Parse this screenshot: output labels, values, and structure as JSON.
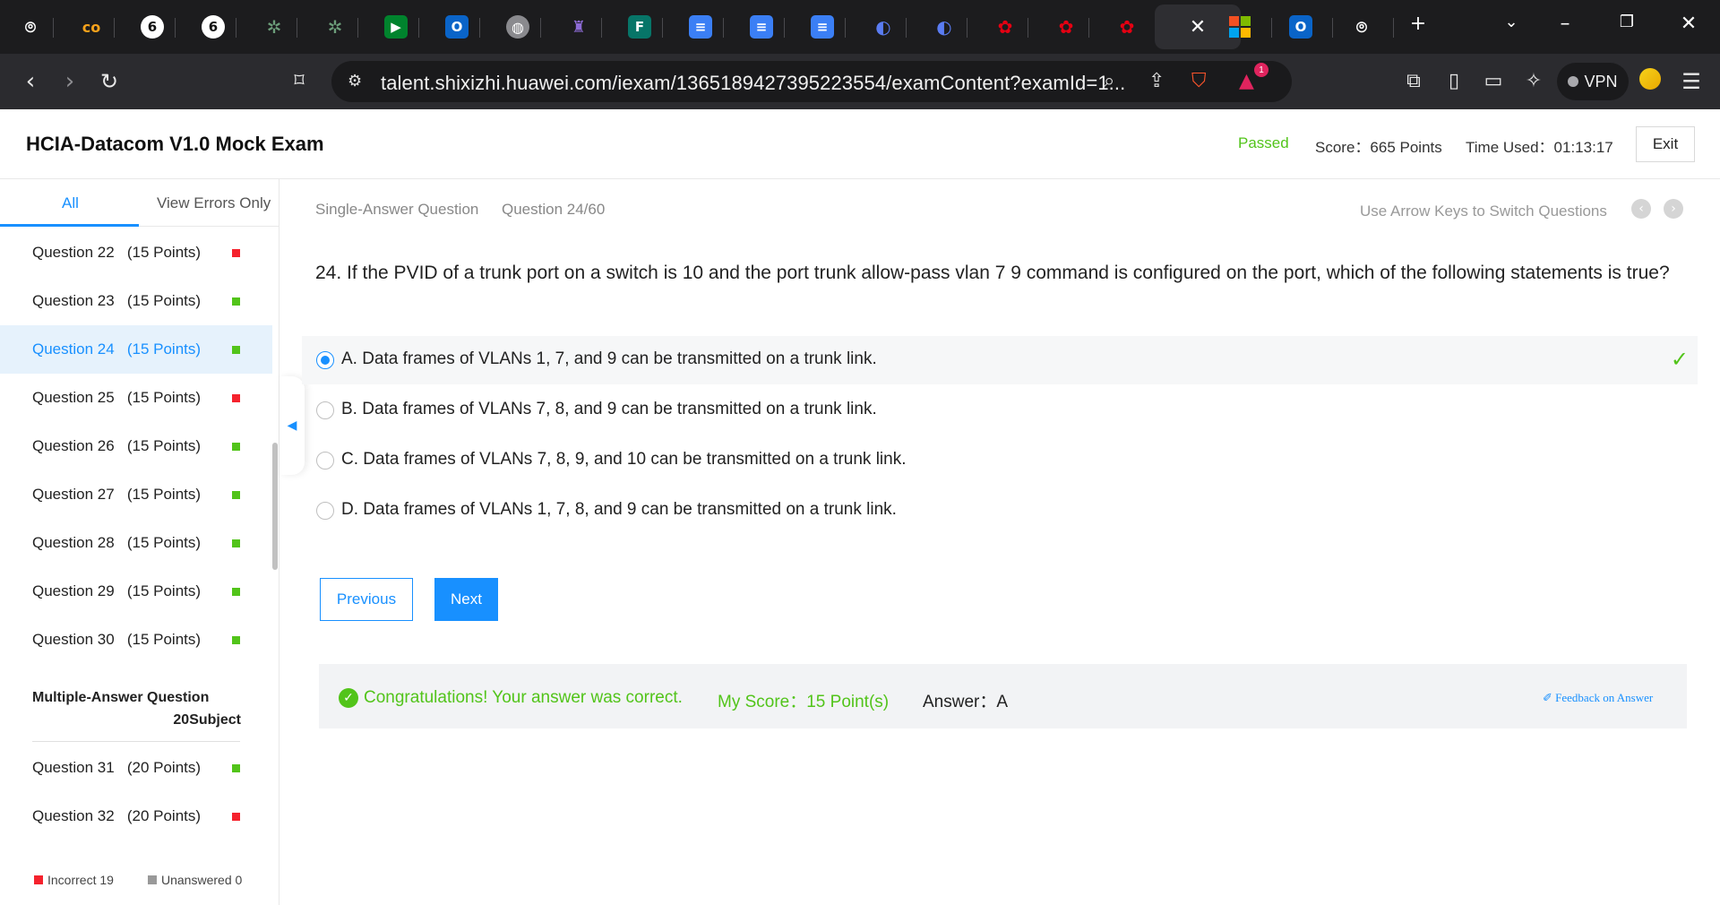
{
  "browser": {
    "tab_icons": [
      "chatgpt-icon",
      "co-icon",
      "six-icon",
      "six-icon",
      "cactus-icon",
      "cactus-icon",
      "meet-icon",
      "outlook-icon",
      "globe-icon",
      "crest-icon",
      "forms-icon",
      "docs-icon",
      "docs-icon",
      "docs-icon",
      "deepseek-icon",
      "deepseek-icon",
      "huawei-icon",
      "huawei-icon",
      "huawei-icon"
    ],
    "url": "talent.shixizhi.huawei.com/iexam/1365189427395223554/examContent?examId=1...",
    "vpn_label": "VPN",
    "notification_count": "1"
  },
  "header": {
    "title": "HCIA-Datacom V1.0 Mock Exam",
    "status": "Passed",
    "score": "Score：665 Points",
    "time_used": "Time Used：01:13:17",
    "exit_label": "Exit"
  },
  "sidebar": {
    "tab_all": "All",
    "tab_errors": "View Errors Only",
    "questions": [
      {
        "label": "Question 22   (15 Points)",
        "status": "incorrect"
      },
      {
        "label": "Question 23   (15 Points)",
        "status": "correct"
      },
      {
        "label": "Question 24   (15 Points)",
        "status": "correct",
        "active": true
      },
      {
        "label": "Question 25   (15 Points)",
        "status": "incorrect"
      },
      {
        "label": "Question 26   (15 Points)",
        "status": "correct"
      },
      {
        "label": "Question 27   (15 Points)",
        "status": "correct"
      },
      {
        "label": "Question 28   (15 Points)",
        "status": "correct"
      },
      {
        "label": "Question 29   (15 Points)",
        "status": "correct"
      },
      {
        "label": "Question 30   (15 Points)",
        "status": "correct"
      }
    ],
    "section_title": "Multiple-Answer Question",
    "section_sub": "20Subject",
    "questions2": [
      {
        "label": "Question 31   (20 Points)",
        "status": "correct"
      },
      {
        "label": "Question 32   (20 Points)",
        "status": "incorrect"
      }
    ],
    "legend_incorrect": "Incorrect 19",
    "legend_unanswered": "Unanswered 0"
  },
  "main": {
    "question_type": "Single-Answer Question",
    "question_number": "Question 24/60",
    "arrow_hint": "Use Arrow Keys to Switch Questions",
    "question_text": "24. If the PVID of a trunk port on a switch is 10 and the port trunk allow-pass vlan 7 9 command is configured on the port, which of the following statements is true?",
    "options": [
      {
        "text": "A. Data frames of VLANs 1, 7, and 9 can be transmitted on a trunk link.",
        "selected": true,
        "correct": true
      },
      {
        "text": "B. Data frames of VLANs 7, 8, and 9 can be transmitted on a trunk link.",
        "selected": false
      },
      {
        "text": "C. Data frames of VLANs 7, 8, 9, and 10 can be transmitted on a trunk link.",
        "selected": false
      },
      {
        "text": "D. Data frames of VLANs 1, 7, 8, and 9 can be transmitted on a trunk link.",
        "selected": false
      }
    ],
    "prev_label": "Previous",
    "next_label": "Next",
    "result_text": "Congratulations! Your answer was correct.",
    "my_score": "My Score：15 Point(s)",
    "answer": "Answer：A",
    "feedback_label": "Feedback on Answer"
  },
  "colors": {
    "accent": "#1890ff",
    "success": "#52c41a",
    "error": "#f5222d"
  }
}
